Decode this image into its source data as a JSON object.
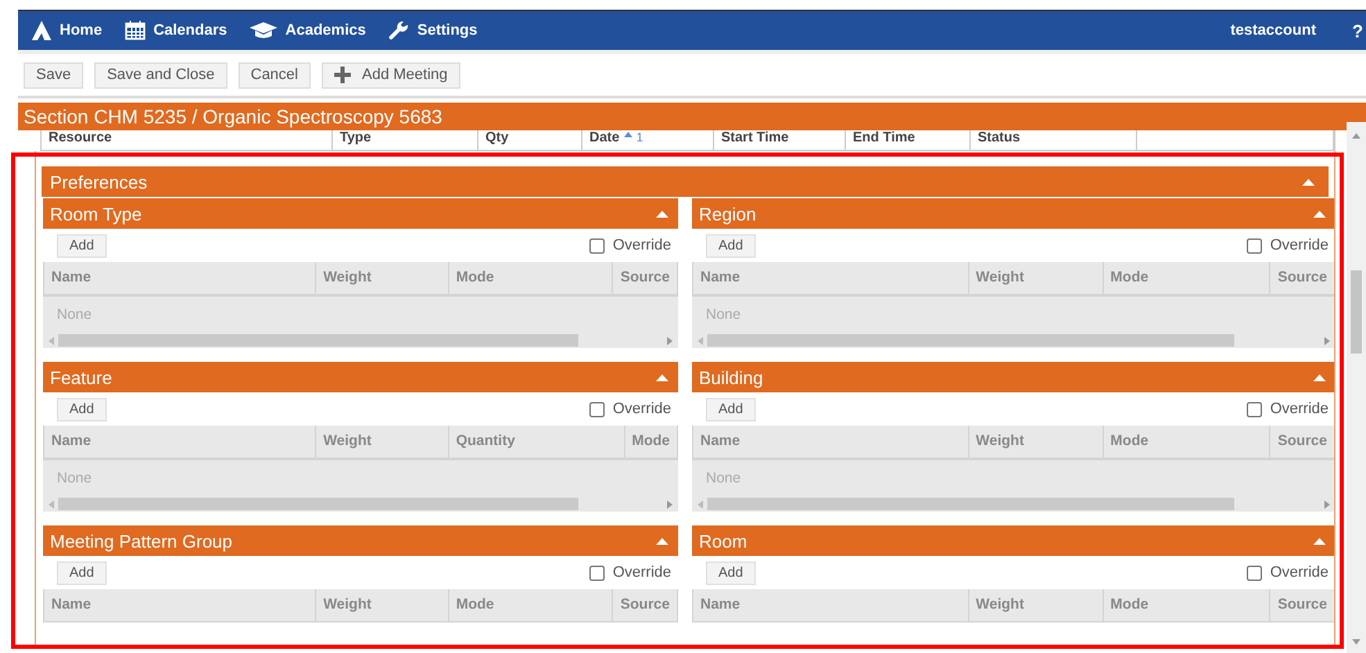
{
  "nav": {
    "items": [
      {
        "label": "Home"
      },
      {
        "label": "Calendars"
      },
      {
        "label": "Academics"
      },
      {
        "label": "Settings"
      }
    ],
    "user": "testaccount",
    "help": "?"
  },
  "toolbar": {
    "buttons": [
      {
        "label": "Save",
        "kind": "text"
      },
      {
        "label": "Save and Close",
        "kind": "text"
      },
      {
        "label": "Cancel",
        "kind": "text"
      },
      {
        "label": "Add Meeting",
        "kind": "add"
      }
    ]
  },
  "section_title": "Section CHM 5235 / Organic Spectroscopy 5683",
  "resource_table": {
    "columns": [
      {
        "label": "Resource"
      },
      {
        "label": "Type"
      },
      {
        "label": "Qty"
      },
      {
        "label": "Date",
        "sort_order": "1"
      },
      {
        "label": "Start Time"
      },
      {
        "label": "End Time"
      },
      {
        "label": "Status"
      }
    ]
  },
  "highlight_frame": true,
  "preferences": {
    "title": "Preferences",
    "expanded": true,
    "panels": [
      {
        "title": "Room Type",
        "expanded": true,
        "add_label": "Add",
        "override": {
          "label": "Override",
          "checked": false
        },
        "columns": [
          "Name",
          "Weight",
          "Mode",
          "Source"
        ],
        "empty_text": "None"
      },
      {
        "title": "Region",
        "expanded": true,
        "add_label": "Add",
        "override": {
          "label": "Override",
          "checked": false
        },
        "columns": [
          "Name",
          "Weight",
          "Mode",
          "Source"
        ],
        "empty_text": "None"
      },
      {
        "title": "Feature",
        "expanded": true,
        "add_label": "Add",
        "override": {
          "label": "Override",
          "checked": false
        },
        "columns": [
          "Name",
          "Weight",
          "Quantity",
          "Mode"
        ],
        "empty_text": "None"
      },
      {
        "title": "Building",
        "expanded": true,
        "add_label": "Add",
        "override": {
          "label": "Override",
          "checked": false
        },
        "columns": [
          "Name",
          "Weight",
          "Mode",
          "Source"
        ],
        "empty_text": "None"
      },
      {
        "title": "Meeting Pattern Group",
        "expanded": true,
        "add_label": "Add",
        "override": {
          "label": "Override",
          "checked": false
        },
        "columns": [
          "Name",
          "Weight",
          "Mode",
          "Source"
        ]
      },
      {
        "title": "Room",
        "expanded": true,
        "add_label": "Add",
        "override": {
          "label": "Override",
          "checked": false
        },
        "columns": [
          "Name",
          "Weight",
          "Mode",
          "Source"
        ]
      }
    ]
  }
}
